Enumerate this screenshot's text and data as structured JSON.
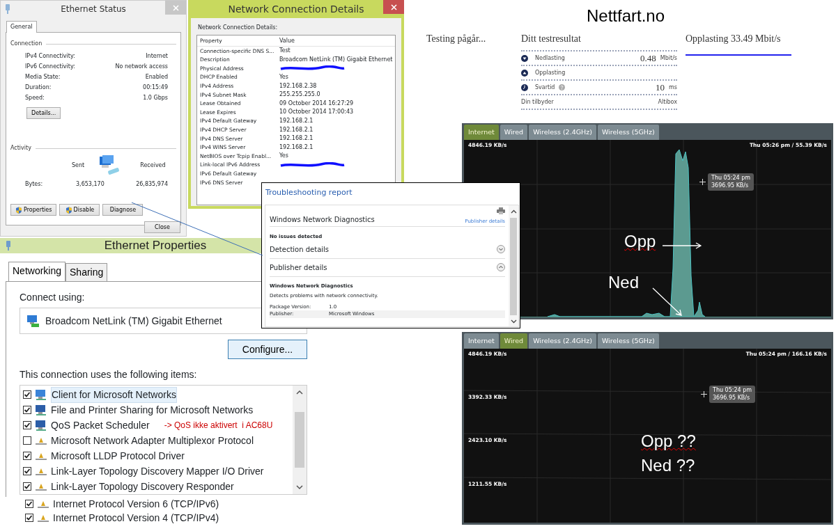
{
  "ethernet_status": {
    "title": "Ethernet Status",
    "tabs": [
      {
        "label": "General",
        "selected": true
      }
    ],
    "connection_heading": "Connection",
    "fields": [
      {
        "label": "IPv4 Connectivity:",
        "value": "Internet"
      },
      {
        "label": "IPv6 Connectivity:",
        "value": "No network access"
      },
      {
        "label": "Media State:",
        "value": "Enabled"
      },
      {
        "label": "Duration:",
        "value": "00:15:49"
      },
      {
        "label": "Speed:",
        "value": "1.0 Gbps"
      }
    ],
    "details_button": "Details...",
    "activity_heading": "Activity",
    "sent_label": "Sent",
    "received_label": "Received",
    "bytes_label": "Bytes:",
    "bytes_sent": "3,653,170",
    "bytes_received": "26,835,974",
    "buttons": [
      {
        "label": "Properties",
        "shield": true
      },
      {
        "label": "Disable",
        "shield": true
      },
      {
        "label": "Diagnose",
        "shield": false
      }
    ],
    "close_button": "Close"
  },
  "connection_details": {
    "title": "Network Connection Details",
    "caption": "Network Connection Details:",
    "columns": [
      "Property",
      "Value"
    ],
    "rows": [
      {
        "property": "Connection-specific DNS S...",
        "value": "Test"
      },
      {
        "property": "Description",
        "value": "Broadcom NetLink (TM) Gigabit Ethernet"
      },
      {
        "property": "Physical Address",
        "redacted": true
      },
      {
        "property": "DHCP Enabled",
        "value": "Yes"
      },
      {
        "property": "IPv4 Address",
        "value": "192.168.2.38"
      },
      {
        "property": "IPv4 Subnet Mask",
        "value": "255.255.255.0"
      },
      {
        "property": "Lease Obtained",
        "value": "09 October 2014 16:27:29"
      },
      {
        "property": "Lease Expires",
        "value": "10 October 2014 17:00:43"
      },
      {
        "property": "IPv4 Default Gateway",
        "value": "192.168.2.1"
      },
      {
        "property": "IPv4 DHCP Server",
        "value": "192.168.2.1"
      },
      {
        "property": "IPv4 DNS Server",
        "value": "192.168.2.1"
      },
      {
        "property": "IPv4 WINS Server",
        "value": "192.168.2.1"
      },
      {
        "property": "NetBIOS over Tcpip Enabl...",
        "value": "Yes"
      },
      {
        "property": "Link-local IPv6 Address",
        "redacted": true
      },
      {
        "property": "IPv6 Default Gateway"
      },
      {
        "property": "IPv6 DNS Server"
      }
    ]
  },
  "speed_test": {
    "site": "Nettfart.no",
    "status": "Testing pågår...",
    "result_heading": "Ditt testresultat",
    "rows": [
      {
        "kind": "down",
        "label": "Nedlasting",
        "value": "0.48",
        "unit": "Mbit/s"
      },
      {
        "kind": "up",
        "label": "Opplasting"
      },
      {
        "kind": "ping",
        "label": "Svartid",
        "help": true,
        "value": "10",
        "unit": "ms"
      },
      {
        "kind": "plain",
        "label": "Din tilbyder",
        "value": "Altibox"
      }
    ],
    "current": "Opplasting 33.49 Mbit/s"
  },
  "troubleshooting": {
    "title": "Troubleshooting report",
    "heading": "Windows Network Diagnostics",
    "publisher_link": "Publisher details",
    "summary": "No issues detected",
    "sections": [
      {
        "label": "Detection details",
        "expanded": false
      },
      {
        "label": "Publisher details",
        "expanded": true
      }
    ],
    "publisher_name": "Windows Network Diagnostics",
    "description": "Detects problems with network connectivity.",
    "info": [
      {
        "label": "Package Version:",
        "value": "1.0"
      },
      {
        "label": "Publisher:",
        "value": "Microsoft Windows"
      }
    ]
  },
  "ethernet_properties": {
    "title": "Ethernet Properties",
    "tabs": [
      {
        "label": "Networking",
        "selected": true
      },
      {
        "label": "Sharing",
        "selected": false
      }
    ],
    "connect_using_label": "Connect using:",
    "adapter": "Broadcom NetLink (TM) Gigabit Ethernet",
    "configure_button": "Configure...",
    "items_label": "This connection uses the following items:",
    "items": [
      {
        "kind": "client",
        "label": "Client for Microsoft Networks",
        "checked": true,
        "selected": true
      },
      {
        "kind": "service",
        "label": "File and Printer Sharing for Microsoft Networks",
        "checked": true,
        "selected": false
      },
      {
        "kind": "service",
        "label": "QoS Packet Scheduler",
        "checked": true,
        "selected": false,
        "note": "-> QoS ikke aktivert  i AC68U"
      },
      {
        "kind": "protocol",
        "label": "Microsoft Network Adapter Multiplexor Protocol",
        "checked": false,
        "selected": false
      },
      {
        "kind": "protocol",
        "label": "Microsoft LLDP Protocol Driver",
        "checked": true,
        "selected": false
      },
      {
        "kind": "protocol",
        "label": "Link-Layer Topology Discovery Mapper I/O Driver",
        "checked": true,
        "selected": false
      },
      {
        "kind": "protocol",
        "label": "Link-Layer Topology Discovery Responder",
        "checked": true,
        "selected": false
      }
    ],
    "extra_items": [
      {
        "kind": "protocol",
        "label": "Internet Protocol Version 6 (TCP/IPv6)",
        "checked": true
      },
      {
        "kind": "protocol",
        "label": "Internet Protocol Version 4 (TCP/IPv4)",
        "checked": true
      }
    ]
  },
  "traffic_monitors": [
    {
      "tabs": [
        {
          "label": "Internet",
          "selected": true
        },
        {
          "label": "Wired",
          "selected": false
        },
        {
          "label": "Wireless (2.4GHz)",
          "selected": false
        },
        {
          "label": "Wireless (5GHz)",
          "selected": false
        }
      ],
      "axis_labels": [
        "4846.19 KB/s"
      ],
      "status": "Thu 05:26 pm / 55.39 KB/s",
      "tooltip": [
        "Thu 05:24 pm",
        "3696.95 KB/s"
      ],
      "traffic": true,
      "annotations": [
        {
          "text": "Opp",
          "arrow": true,
          "misspelled": true
        },
        {
          "text": "Ned",
          "arrow": true,
          "misspelled": false
        }
      ]
    },
    {
      "tabs": [
        {
          "label": "Internet",
          "selected": false
        },
        {
          "label": "Wired",
          "selected": true
        },
        {
          "label": "Wireless (2.4GHz)",
          "selected": false
        },
        {
          "label": "Wireless (5GHz)",
          "selected": false
        }
      ],
      "axis_labels": [
        "4846.19 KB/s",
        "3392.33 KB/s",
        "2423.10 KB/s",
        "1211.55 KB/s"
      ],
      "status": "Thu 05:24 pm / 166.16 KB/s",
      "tooltip": [
        "Thu 05:24 pm",
        "3696.95 KB/s"
      ],
      "traffic": false,
      "annotations": [
        {
          "text": "Opp ??",
          "arrow": false,
          "misspelled": true
        },
        {
          "text": "Ned ??",
          "arrow": false,
          "misspelled": false
        }
      ]
    }
  ]
}
